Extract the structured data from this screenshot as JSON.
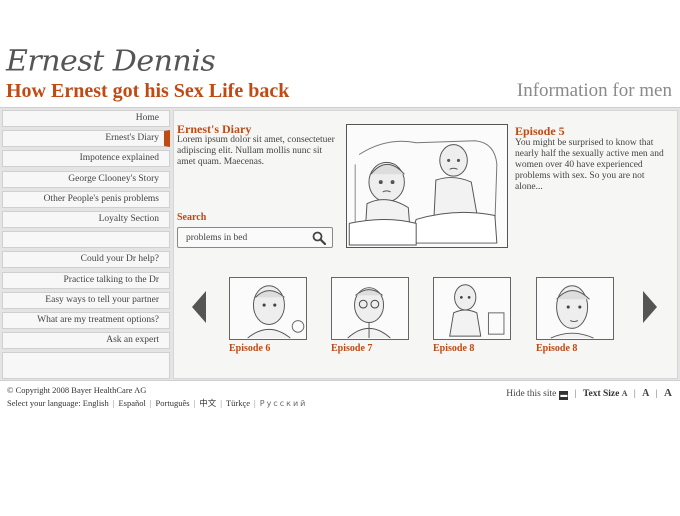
{
  "header": {
    "logo": "Ernest Dennis",
    "tagline": "How Ernest got his Sex Life back",
    "section": "Information for men"
  },
  "nav": {
    "items": [
      {
        "label": "Home"
      },
      {
        "label": "Ernest's Diary",
        "active": true
      },
      {
        "label": "Impotence explained"
      },
      {
        "label": "George Clooney's Story"
      },
      {
        "label": "Other People's penis problems"
      },
      {
        "label": "Loyalty Section"
      },
      {
        "label": ""
      },
      {
        "label": "Could your Dr help?"
      },
      {
        "label": "Practice talking to the Dr"
      },
      {
        "label": "Easy ways to tell your partner"
      },
      {
        "label": "What are my treatment options?"
      },
      {
        "label": "Ask an expert"
      }
    ]
  },
  "diary": {
    "title": "Ernest's Diary",
    "text": "Lorem ipsum dolor sit amet, consectetuer adipiscing elit. Nullam mollis nunc sit amet quam. Maecenas."
  },
  "search": {
    "label": "Search",
    "value": "problems in bed"
  },
  "feature": {
    "title": "Episode 5",
    "text": "You might be surprised to know that nearly half the sexually active men and women over 40 have experienced problems with sex. So you are not alone..."
  },
  "episodes": [
    {
      "label": "Episode 6"
    },
    {
      "label": "Episode 7"
    },
    {
      "label": "Episode 8"
    },
    {
      "label": "Episode 8"
    }
  ],
  "footer": {
    "copyright": "© Copyright 2008 Bayer HealthCare AG",
    "language_prompt": "Select your language:",
    "languages": [
      "English",
      "Español",
      "Português",
      "中文",
      "Türkçe",
      "Русский"
    ],
    "hide_site": "Hide this site",
    "text_size": "Text Size",
    "sizes": [
      "A",
      "A",
      "A"
    ]
  },
  "colors": {
    "accent": "#c04a14",
    "frame": "#e4e4e4",
    "panel": "#f6f6f4"
  }
}
